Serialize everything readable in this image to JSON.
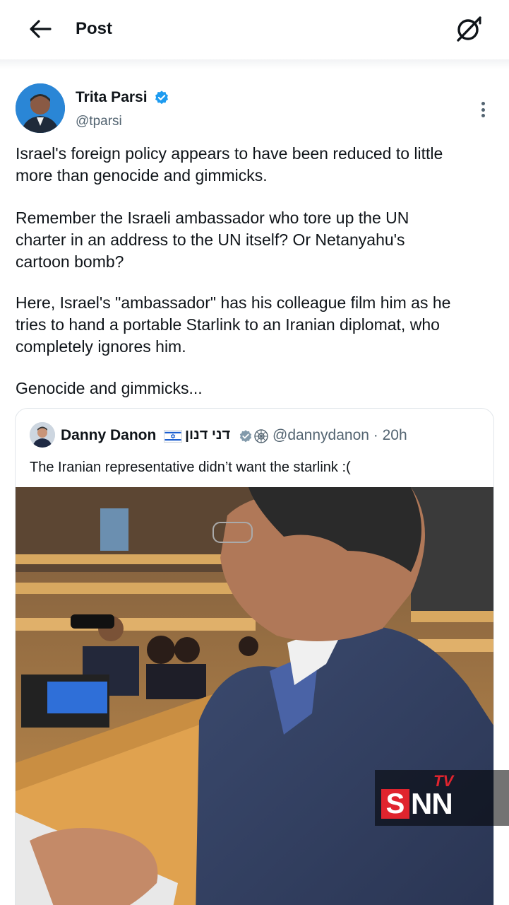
{
  "header": {
    "title": "Post",
    "back_icon": "arrow-left-icon",
    "grok_icon": "grok-icon"
  },
  "author": {
    "name": "Trita Parsi",
    "handle": "@tparsi",
    "verified": true
  },
  "post": {
    "paragraphs": [
      "Israel's foreign policy appears to have been reduced to little\nmore than genocide and gimmicks.",
      "Remember the Israeli ambassador who tore up the UN\ncharter in an address to the UN itself? Or Netanyahu's\ncartoon bomb?",
      "Here, Israel's \"ambassador\" has his colleague film him as he\ntries to hand a portable Starlink to an Iranian diplomat, who\ncompletely ignores him.",
      "Genocide and gimmicks..."
    ]
  },
  "quote": {
    "name": "Danny Danon",
    "name_hebrew": "דני דנון",
    "flag": "🇮🇱",
    "handle_time": "@dannydanon · 20h",
    "text": "The Iranian representative didn’t want the starlink :("
  },
  "watermark": {
    "tv": "TV",
    "s": "S",
    "nn": "NN"
  },
  "colors": {
    "text": "#0f1419",
    "secondary": "#536471",
    "verified_blue": "#1d9bf0",
    "border": "#e1e6ea",
    "snn_red": "#e0242e"
  }
}
